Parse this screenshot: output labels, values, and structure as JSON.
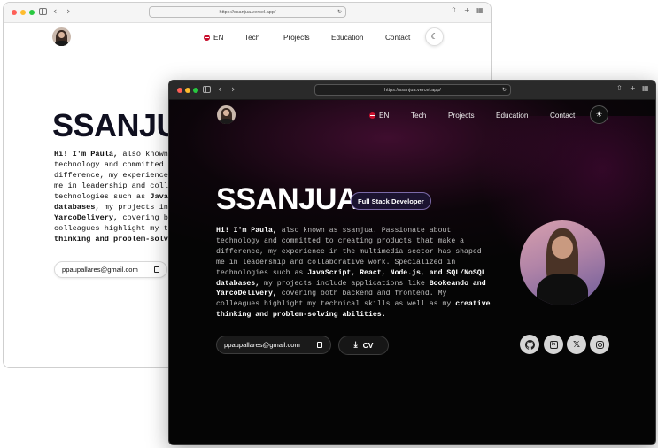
{
  "url": "https://ssanjua.vercel.app/",
  "light": {
    "nav": {
      "lang": "EN",
      "tech": "Tech",
      "projects": "Projects",
      "education": "Education",
      "contact": "Contact"
    },
    "title": "SSANJUA",
    "text": {
      "l1a": "Hi! I'm Paula,",
      "l1b": " also known",
      "l2": "technology and committed",
      "l3": "difference, my experience",
      "l4": "me in leadership and coll",
      "l5a": "technologies such as ",
      "l5b": "Java",
      "l6a": "databases,",
      "l6b": " my projects in",
      "l7a": "YarcoDelivery,",
      "l7b": " covering b",
      "l8": "colleagues highlight my t",
      "l9a": "thinking and problem-solv"
    },
    "email": "ppaupallares@gmail.com"
  },
  "dark": {
    "nav": {
      "lang": "EN",
      "tech": "Tech",
      "projects": "Projects",
      "education": "Education",
      "contact": "Contact"
    },
    "title": "SSANJUA",
    "badge": "Full Stack Developer",
    "text": {
      "l1a": "Hi! I'm Paula,",
      "l1b": " also known as ssanjua. Passionate about",
      "l2": "technology and committed to creating products that make a",
      "l3": "difference, my experience in the multimedia sector has shaped",
      "l4": "me in leadership and collaborative work. Specialized in",
      "l5a": "technologies such as ",
      "l5b": "JavaScript, React, Node.js, and SQL/NoSQL",
      "l6a": "databases,",
      "l6b": " my projects include applications like ",
      "l6c": "Bookeando and",
      "l7a": "YarcoDelivery,",
      "l7b": " covering both backend and frontend. My",
      "l8a": "colleagues highlight my technical skills as well as my ",
      "l8b": "creative",
      "l9": "thinking and problem-solving abilities."
    },
    "email": "ppaupallares@gmail.com",
    "cv": "CV",
    "socials": [
      "github-icon",
      "linkedin-icon",
      "x-icon",
      "instagram-icon"
    ]
  }
}
